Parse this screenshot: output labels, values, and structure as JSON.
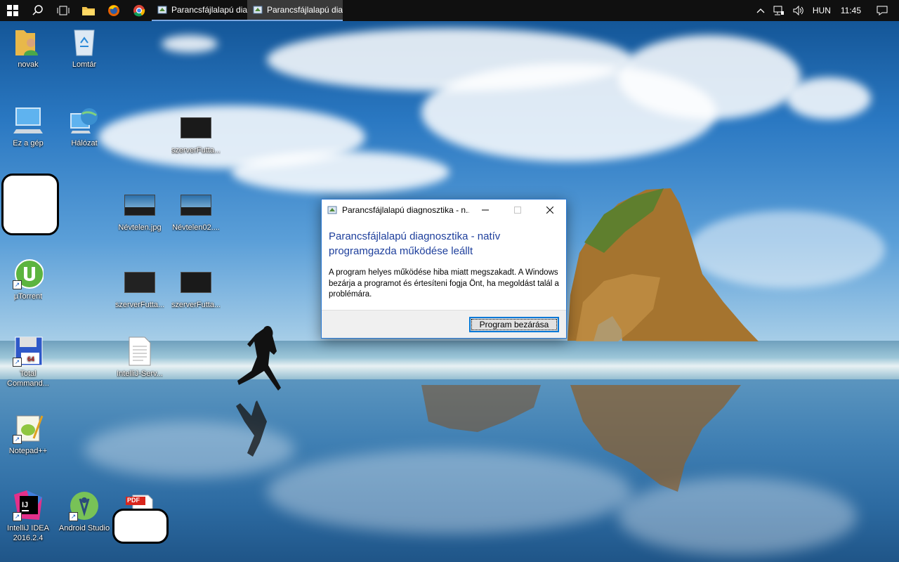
{
  "taskbar": {
    "tasks": [
      {
        "label": "Parancsfájlalapú diag...",
        "icon": "script-host-icon"
      },
      {
        "label": "Parancsfájlalapú diag...",
        "icon": "script-host-icon"
      }
    ],
    "tray": {
      "language": "HUN",
      "time": "11:45"
    }
  },
  "desktop": {
    "icons": [
      {
        "label": "novak",
        "icon": "user-folder-icon"
      },
      {
        "label": "Lomtár",
        "icon": "recycle-bin-icon"
      },
      {
        "label": "Ez a gép",
        "icon": "computer-icon"
      },
      {
        "label": "Hálózat",
        "icon": "network-icon"
      },
      {
        "label": "szerverFutta...",
        "icon": "screenshot-thumbnail-icon"
      },
      {
        "label": "Névtelen.jpg",
        "icon": "image-thumbnail-icon"
      },
      {
        "label": "Névtelen02....",
        "icon": "image-thumbnail-icon"
      },
      {
        "label": "µTorrent",
        "icon": "utorrent-icon"
      },
      {
        "label": "szerverFutta...",
        "icon": "screenshot-thumbnail-icon"
      },
      {
        "label": "szerverFutta...",
        "icon": "screenshot-thumbnail-icon"
      },
      {
        "label": "Total Command...",
        "icon": "total-commander-icon"
      },
      {
        "label": "IntelliJ-Serv...",
        "icon": "text-document-icon"
      },
      {
        "label": "Notepad++",
        "icon": "notepadpp-icon"
      },
      {
        "label": "IntelliJ IDEA 2016.2.4",
        "icon": "intellij-icon"
      },
      {
        "label": "Android Studio",
        "icon": "android-studio-icon"
      },
      {
        "label": "",
        "icon": "pdf-icon",
        "badge": "PDF"
      }
    ]
  },
  "dialog": {
    "title": "Parancsfájlalapú diagnosztika - n...",
    "heading": "Parancsfájlalapú diagnosztika - natív programgazda működése leállt",
    "body": "A program helyes működése hiba miatt megszakadt. A Windows bezárja a programot és értesíteni fogja Önt, ha megoldást talál a problémára.",
    "close_button_label": "Program bezárása"
  },
  "colors": {
    "taskbar": "#101010",
    "accent": "#0078d7",
    "dialog_heading": "#1e3f9c"
  }
}
